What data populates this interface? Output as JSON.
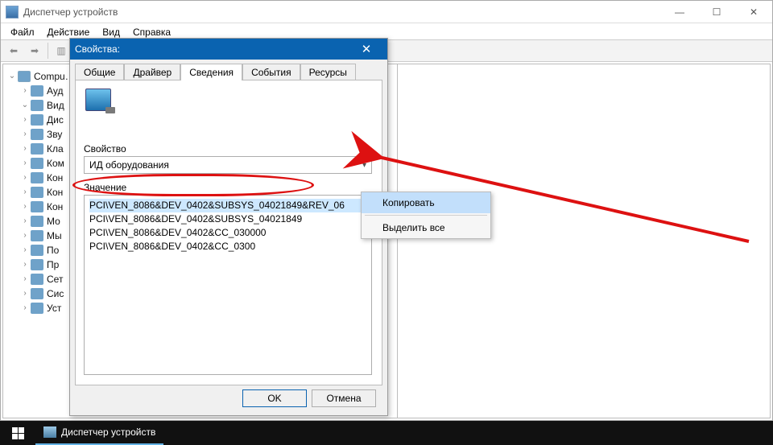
{
  "main_window": {
    "title": "Диспетчер устройств",
    "menu": {
      "file": "Файл",
      "action": "Действие",
      "view": "Вид",
      "help": "Справка"
    },
    "tree": {
      "root": "Compu…",
      "items": [
        {
          "label": "Ауд",
          "cls": "ic-aud"
        },
        {
          "label": "Вид",
          "cls": "ic-vid",
          "expanded": true
        },
        {
          "label": "Дис",
          "cls": "ic-disk"
        },
        {
          "label": "Зву",
          "cls": "ic-snd"
        },
        {
          "label": "Кла",
          "cls": "ic-kbd"
        },
        {
          "label": "Ком",
          "cls": "ic-mon"
        },
        {
          "label": "Кон",
          "cls": "ic-ctrl"
        },
        {
          "label": "Кон",
          "cls": "ic-usb"
        },
        {
          "label": "Кон",
          "cls": "ic-hid"
        },
        {
          "label": "Мо",
          "cls": "ic-mon"
        },
        {
          "label": "Мы",
          "cls": "ic-mouse"
        },
        {
          "label": "По",
          "cls": "ic-port"
        },
        {
          "label": "Пр",
          "cls": "ic-cpu"
        },
        {
          "label": "Сет",
          "cls": "ic-net"
        },
        {
          "label": "Сис",
          "cls": "ic-sys"
        },
        {
          "label": "Уст",
          "cls": "ic-print"
        }
      ]
    }
  },
  "dialog": {
    "title": "Свойства:",
    "tabs": {
      "general": "Общие",
      "driver": "Драйвер",
      "details": "Сведения",
      "events": "События",
      "resources": "Ресурсы"
    },
    "property_label": "Свойство",
    "property_value": "ИД оборудования",
    "value_label": "Значение",
    "hwids": [
      "PCI\\VEN_8086&DEV_0402&SUBSYS_04021849&REV_06",
      "PCI\\VEN_8086&DEV_0402&SUBSYS_04021849",
      "PCI\\VEN_8086&DEV_0402&CC_030000",
      "PCI\\VEN_8086&DEV_0402&CC_0300"
    ],
    "buttons": {
      "ok": "OK",
      "cancel": "Отмена"
    }
  },
  "context_menu": {
    "copy": "Копировать",
    "select_all": "Выделить все"
  },
  "taskbar": {
    "app": "Диспетчер устройств"
  },
  "win_buttons": {
    "min": "—",
    "max": "☐",
    "close": "✕"
  }
}
